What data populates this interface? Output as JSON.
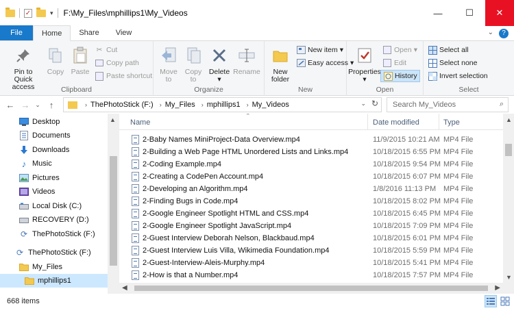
{
  "title": "F:\\My_Files\\mphillips1\\My_Videos",
  "window": {
    "minimize": "—",
    "maximize": "☐",
    "close": "✕"
  },
  "tabs": [
    {
      "label": "File"
    },
    {
      "label": "Home"
    },
    {
      "label": "Share"
    },
    {
      "label": "View"
    }
  ],
  "ribbon": {
    "clipboard": {
      "label": "Clipboard",
      "pin": "Pin to Quick",
      "pin2": "access",
      "copy": "Copy",
      "paste": "Paste",
      "cut": "Cut",
      "copy_path": "Copy path",
      "paste_shortcut": "Paste shortcut"
    },
    "organize": {
      "label": "Organize",
      "move_to": "Move",
      "move_to2": "to",
      "copy_to": "Copy",
      "copy_to2": "to",
      "delete": "Delete",
      "rename": "Rename"
    },
    "new": {
      "label": "New",
      "new_folder": "New",
      "new_folder2": "folder",
      "new_item": "New item",
      "easy_access": "Easy access"
    },
    "open": {
      "label": "Open",
      "properties": "Properties",
      "open": "Open",
      "edit": "Edit",
      "history": "History"
    },
    "select": {
      "label": "Select",
      "select_all": "Select all",
      "select_none": "Select none",
      "invert": "Invert selection"
    }
  },
  "address": {
    "crumbs": [
      "ThePhotoStick (F:)",
      "My_Files",
      "mphillips1",
      "My_Videos"
    ]
  },
  "search": {
    "placeholder": "Search My_Videos"
  },
  "nav": [
    {
      "label": "Desktop"
    },
    {
      "label": "Documents"
    },
    {
      "label": "Downloads"
    },
    {
      "label": "Music"
    },
    {
      "label": "Pictures"
    },
    {
      "label": "Videos"
    },
    {
      "label": "Local Disk (C:)"
    },
    {
      "label": "RECOVERY (D:)"
    },
    {
      "label": "ThePhotoStick (F:)"
    },
    {
      "label": "ThePhotoStick (F:)"
    },
    {
      "label": "My_Files"
    },
    {
      "label": "mphillips1"
    }
  ],
  "columns": {
    "name": "Name",
    "date": "Date modified",
    "type": "Type"
  },
  "files": [
    {
      "name": "2-Baby Names MiniProject-Data Overview.mp4",
      "date": "11/9/2015 10:21 AM",
      "type": "MP4 File"
    },
    {
      "name": "2-Building a Web Page HTML Unordered Lists and Links.mp4",
      "date": "10/18/2015 6:55 PM",
      "type": "MP4 File"
    },
    {
      "name": "2-Coding Example.mp4",
      "date": "10/18/2015 9:54 PM",
      "type": "MP4 File"
    },
    {
      "name": "2-Creating a CodePen Account.mp4",
      "date": "10/18/2015 6:07 PM",
      "type": "MP4 File"
    },
    {
      "name": "2-Developing an Algorithm.mp4",
      "date": "1/8/2016 11:13 PM",
      "type": "MP4 File"
    },
    {
      "name": "2-Finding Bugs in Code.mp4",
      "date": "10/18/2015 8:02 PM",
      "type": "MP4 File"
    },
    {
      "name": "2-Google Engineer Spotlight HTML and CSS.mp4",
      "date": "10/18/2015 6:45 PM",
      "type": "MP4 File"
    },
    {
      "name": "2-Google Engineer Spotlight JavaScript.mp4",
      "date": "10/18/2015 7:09 PM",
      "type": "MP4 File"
    },
    {
      "name": "2-Guest Interview Deborah Nelson, Blackbaud.mp4",
      "date": "10/18/2015 6:01 PM",
      "type": "MP4 File"
    },
    {
      "name": "2-Guest Interview Luis Villa, Wikimedia Foundation.mp4",
      "date": "10/18/2015 5:59 PM",
      "type": "MP4 File"
    },
    {
      "name": "2-Guest-Interview-Aleis-Murphy.mp4",
      "date": "10/18/2015 5:41 PM",
      "type": "MP4 File"
    },
    {
      "name": "2-How is that a Number.mp4",
      "date": "10/18/2015 7:57 PM",
      "type": "MP4 File"
    }
  ],
  "status": {
    "count": "668 items"
  },
  "colors": {
    "accent": "#1979ca",
    "selection": "#cce8ff",
    "close": "#e81123"
  }
}
